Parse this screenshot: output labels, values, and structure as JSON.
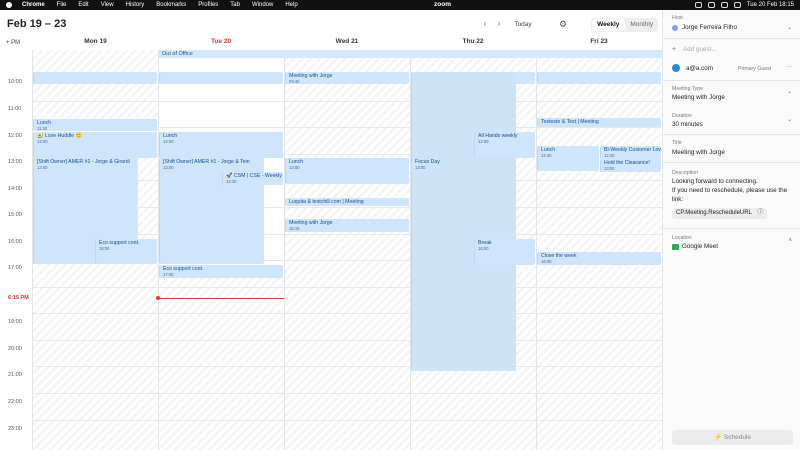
{
  "menubar": {
    "items": [
      "Chrome",
      "File",
      "Edit",
      "View",
      "History",
      "Bookmarks",
      "Profiles",
      "Tab",
      "Window",
      "Help"
    ],
    "center_app": "zoom",
    "clock": "Tue 20 Feb 18:15"
  },
  "header": {
    "range": "Feb 19 – 23",
    "prev": "‹",
    "next": "›",
    "today": "Today",
    "views": [
      "Weekly",
      "Monthly"
    ],
    "active_view": "Weekly"
  },
  "calendar": {
    "timezone": "+ PM",
    "days": [
      "Mon 19",
      "Tue 20",
      "Wed 21",
      "Thu 22",
      "Fri 23"
    ],
    "today_index": 1,
    "hours": [
      "10:00",
      "11:00",
      "12:00",
      "13:00",
      "14:00",
      "15:00",
      "16:00",
      "17:00",
      "18:00",
      "19:00",
      "20:00",
      "21:00",
      "22:00",
      "23:00"
    ],
    "now_label": "6:15 PM",
    "allday": "Out of Office",
    "events": [
      {
        "title": "Lunch",
        "sub": "11:30"
      },
      {
        "title": "🥑 Love Huddle 🙂",
        "sub": "12:00"
      },
      {
        "title": "[Shift Owner] AMER #1 - Jorge & Girardi",
        "sub": "13:00"
      },
      {
        "title": "Eco support cont.",
        "sub": "16:00"
      },
      {
        "title": "Lunch",
        "sub": "12:00"
      },
      {
        "title": "[Shift Owner] AMER #1 - Jorge & Tein",
        "sub": "13:00"
      },
      {
        "title": "🚀 CSM | CSE - Weekly T",
        "sub": "13:30"
      },
      {
        "title": "Eco support cont.",
        "sub": "17:00"
      },
      {
        "title": "Meeting with Jorge",
        "sub": "09:45"
      },
      {
        "title": "Lunch",
        "sub": "13:00"
      },
      {
        "title": "Luquita & testchili.com | Meeting",
        "sub": ""
      },
      {
        "title": "Meeting with Jorge",
        "sub": "15:15"
      },
      {
        "title": "Focus Day",
        "sub": "13:00"
      },
      {
        "title": "All Hands weekly",
        "sub": "12:00"
      },
      {
        "title": "Break",
        "sub": "16:00"
      },
      {
        "title": "Testeste & Test | Meeting",
        "sub": ""
      },
      {
        "title": "Lunch",
        "sub": "12:30"
      },
      {
        "title": "Bi-Weekly Customer Lov",
        "sub": "12:30"
      },
      {
        "title": "Hold the Clearance!",
        "sub": "13:00"
      },
      {
        "title": "Close the week",
        "sub": "16:30"
      }
    ]
  },
  "panel": {
    "host_label": "Host",
    "host_name": "Jorge Ferreira Filho",
    "add_guest_placeholder": "Add guest...",
    "guest_email": "a@a.com",
    "guest_role": "Primary Guest",
    "meeting_type_label": "Meeting Type",
    "meeting_type_value": "Meeting with Jorge",
    "duration_label": "Duration",
    "duration_value": "30 minutes",
    "title_label": "Title",
    "title_value": "Meeting with Jorge",
    "description_label": "Description",
    "description_line1": "Looking forward to connecting.",
    "description_line2": "If you need to reschedule, please use the",
    "description_line3": "link:",
    "reschedule_chip": "CP.Meeting.RescheduleURL",
    "location_label": "Location",
    "location_value": "Google Meet",
    "schedule_button": "Schedule"
  }
}
